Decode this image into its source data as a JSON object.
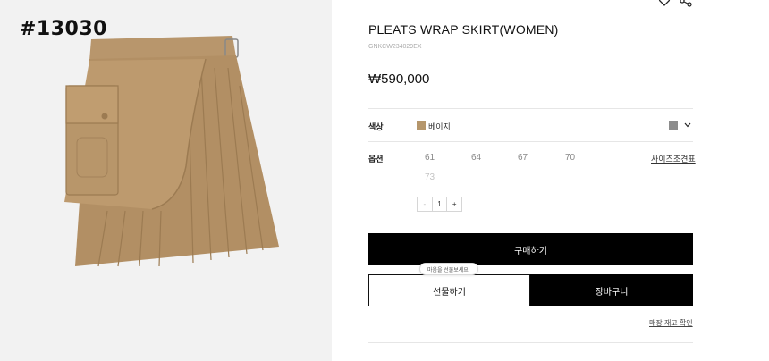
{
  "badge": {
    "code": "#13030"
  },
  "product": {
    "title": "PLEATS WRAP SKIRT(WOMEN)",
    "sku": "GNKCW234029EX",
    "price": "₩590,000"
  },
  "options": {
    "color_label": "색상",
    "color_value": "베이지",
    "color_swatch": "#b5966b",
    "size_label": "옵션",
    "sizes": [
      "61",
      "64",
      "67",
      "70",
      "73"
    ],
    "size_chart_link": "사이즈조견표"
  },
  "quantity": {
    "minus": "-",
    "value": "1",
    "plus": "+"
  },
  "actions": {
    "buy": "구매하기",
    "gift_tooltip": "마음을 선물보세요!",
    "gift": "선물하기",
    "cart": "장바구니",
    "stock_check": "매장 재고 확인"
  },
  "icons": {
    "wishlist": "heart-icon",
    "share": "share-icon",
    "dropdown": "chevron-down-icon"
  }
}
